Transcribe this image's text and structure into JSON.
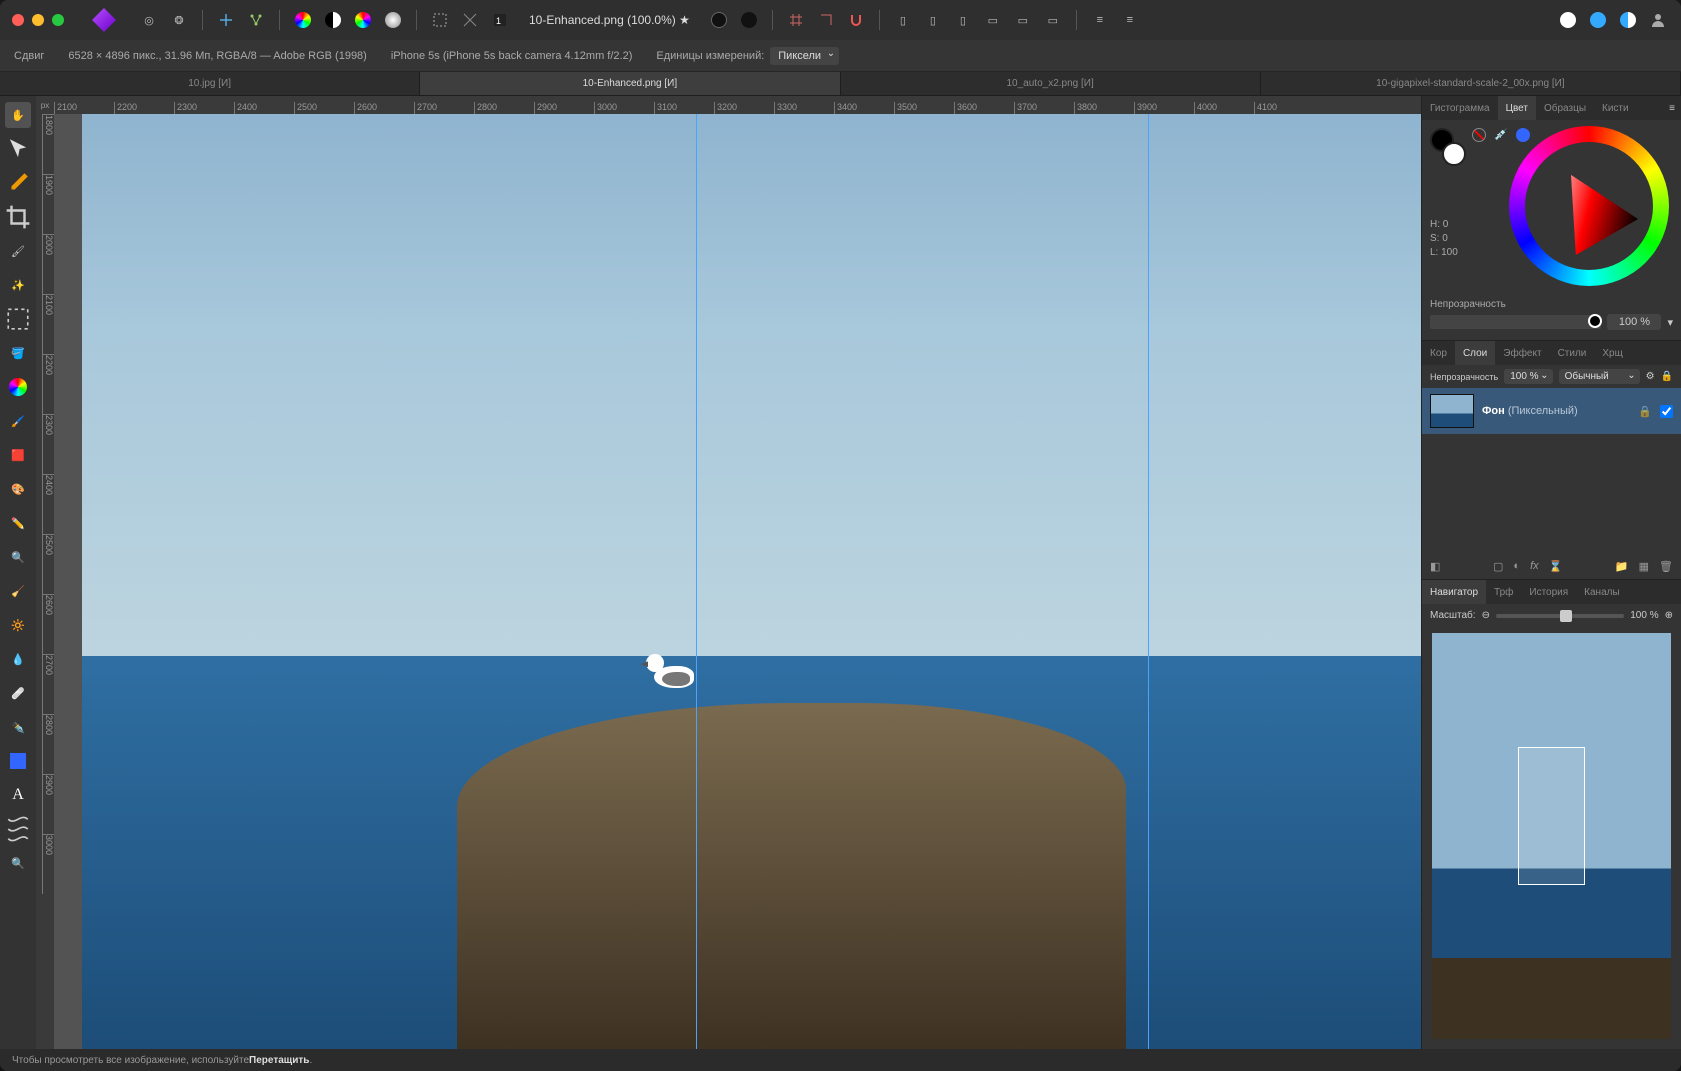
{
  "titlebar": {
    "filename": "10-Enhanced.png (100.0%) ★"
  },
  "contextbar": {
    "tool_label": "Сдвиг",
    "dims": "6528 × 4896 пикс., 31.96 Мп, RGBA/8 — Adobe RGB (1998)",
    "camera": "iPhone 5s (iPhone 5s back camera 4.12mm f/2.2)",
    "units_label": "Единицы измерений:",
    "units_value": "Пиксели"
  },
  "tabs": [
    {
      "label": "10.jpg [И]",
      "active": false
    },
    {
      "label": "10-Enhanced.png [И]",
      "active": true
    },
    {
      "label": "10_auto_x2.png [И]",
      "active": false
    },
    {
      "label": "10-gigapixel-standard-scale-2_00x.png [И]",
      "active": false
    }
  ],
  "ruler": {
    "unit": "px",
    "h": [
      "2100",
      "2200",
      "2300",
      "2400",
      "2500",
      "2600",
      "2700",
      "2800",
      "2900",
      "3000",
      "3100",
      "3200",
      "3300",
      "3400",
      "3500",
      "3600",
      "3700",
      "3800",
      "3900",
      "4000",
      "4100"
    ],
    "v": [
      "1800",
      "1900",
      "2000",
      "2100",
      "2200",
      "2300",
      "2400",
      "2500",
      "2600",
      "2700",
      "2800",
      "2900",
      "3000"
    ]
  },
  "panels": {
    "color_tabs": [
      "Гистограмма",
      "Цвет",
      "Образцы",
      "Кисти"
    ],
    "color_active": 1,
    "hsl": {
      "H": "H: 0",
      "S": "S: 0",
      "L": "L: 100"
    },
    "opacity_label": "Непрозрачность",
    "opacity_value": "100 %",
    "layers_tabs": [
      "Кор",
      "Слои",
      "Эффект",
      "Стили",
      "Хрщ"
    ],
    "layers_active": 1,
    "layers_opacity_label": "Непрозрачность",
    "layers_opacity_value": "100 %",
    "blend_mode": "Обычный",
    "layer_name": "Фон",
    "layer_type": "(Пиксельный)",
    "nav_tabs": [
      "Навигатор",
      "Трф",
      "История",
      "Каналы"
    ],
    "nav_active": 0,
    "zoom_label": "Масштаб:",
    "zoom_value": "100 %"
  },
  "status": {
    "hint_prefix": "Чтобы просмотреть все изображение, используйте ",
    "hint_action": "Перетащить",
    "hint_suffix": "."
  }
}
